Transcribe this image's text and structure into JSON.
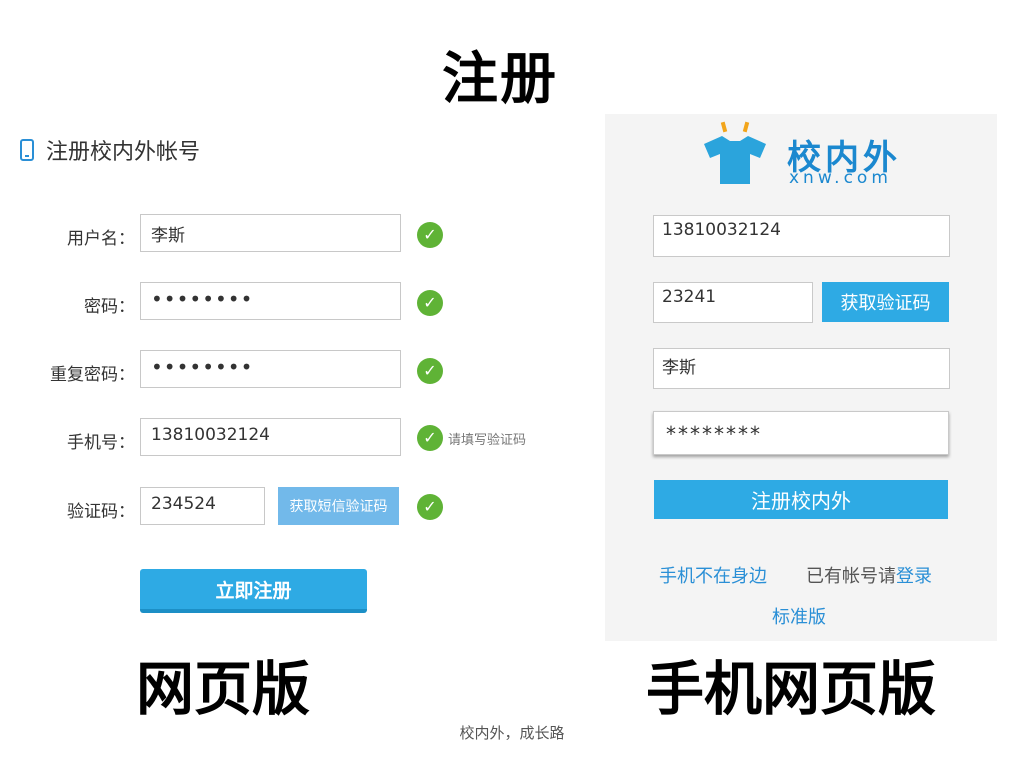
{
  "page_title": "注册",
  "web": {
    "heading": "注册校内外帐号",
    "username_label": "用户名：",
    "username_value": "李斯",
    "password_label": "密码：",
    "password_value": "••••••••",
    "confirm_label": "重复密码：",
    "confirm_value": "••••••••",
    "phone_label": "手机号：",
    "phone_value": "13810032124",
    "phone_hint": "请填写验证码",
    "code_label": "验证码：",
    "code_value": "234524",
    "sms_button": "获取短信验证码",
    "submit_button": "立即注册",
    "check_icon": "check-icon",
    "caption": "网页版"
  },
  "mobile": {
    "logo_brand": "校内外",
    "logo_domain": "xnw.com",
    "phone_value": "13810032124",
    "code_value": "23241",
    "get_code_button": "获取验证码",
    "name_value": "李斯",
    "password_value": "********",
    "submit_button": "注册校内外",
    "link_phone_absent": "手机不在身边",
    "have_account_text": "已有帐号请",
    "login_link": "登录",
    "standard_link": "标准版",
    "caption": "手机网页版"
  },
  "footer": "校内外，成长路",
  "colors": {
    "accent": "#2eaae4",
    "success": "#5fb336",
    "link": "#2a8fd6"
  }
}
